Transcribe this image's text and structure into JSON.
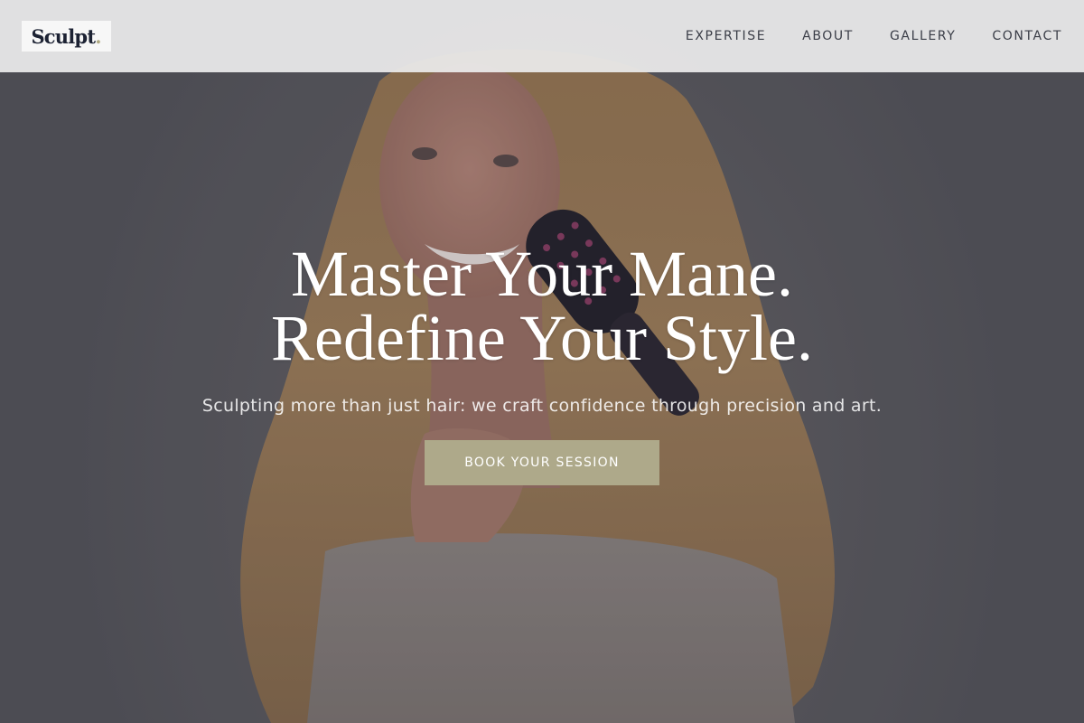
{
  "brand": {
    "logo_text": "Sculpt",
    "logo_dot": ".",
    "text_color": "#1c2233",
    "accent_color": "#b0aa82"
  },
  "nav": {
    "items": [
      {
        "label": "EXPERTISE"
      },
      {
        "label": "ABOUT"
      },
      {
        "label": "GALLERY"
      },
      {
        "label": "CONTACT"
      }
    ]
  },
  "hero": {
    "headline_line1": "Master Your Mane.",
    "headline_line2": "Redefine Your Style.",
    "subheading": "Sculpting more than just hair: we craft confidence through precision and art.",
    "cta_label": "BOOK YOUR SESSION",
    "cta_color": "#aea98a",
    "image_description": "smiling-woman-brushing-long-blonde-hair"
  }
}
